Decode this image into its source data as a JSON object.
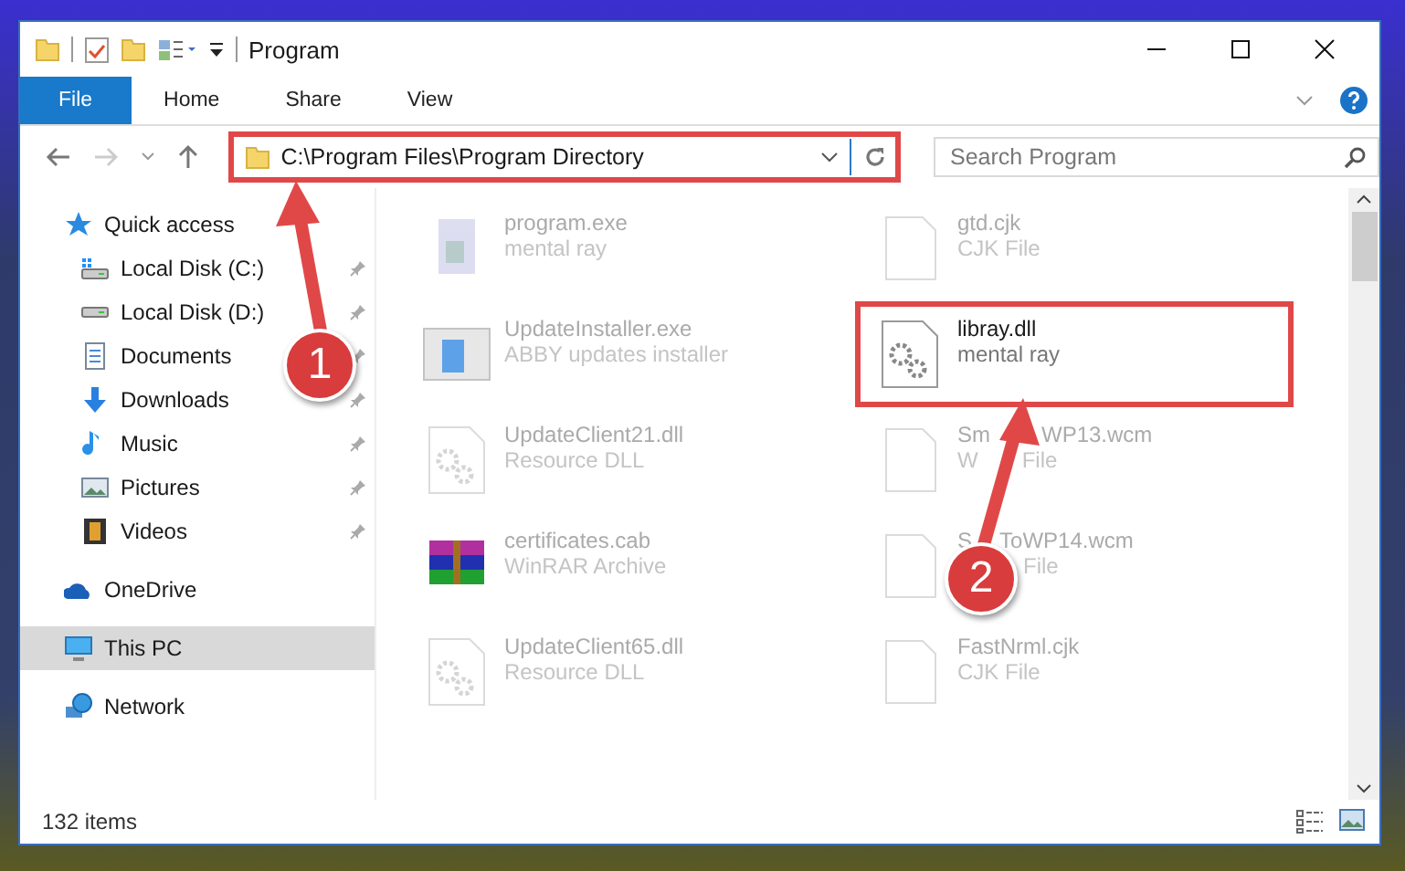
{
  "window": {
    "title": "Program"
  },
  "ribbon": {
    "tabs": [
      {
        "label": "File",
        "selected": true
      },
      {
        "label": "Home",
        "selected": false
      },
      {
        "label": "Share",
        "selected": false
      },
      {
        "label": "View",
        "selected": false
      }
    ]
  },
  "address": {
    "path": "C:\\Program Files\\Program Directory",
    "highlighted": true
  },
  "search": {
    "placeholder": "Search Program"
  },
  "sidebar": {
    "items": [
      {
        "label": "Quick access",
        "kind": "star",
        "selected": false,
        "children": [
          {
            "label": "Local Disk (C:)",
            "kind": "disk-c",
            "pinned": true,
            "selected": false
          },
          {
            "label": "Local Disk (D:)",
            "kind": "disk",
            "pinned": true,
            "selected": false
          },
          {
            "label": "Documents",
            "kind": "document",
            "pinned": true,
            "selected": false
          },
          {
            "label": "Downloads",
            "kind": "download",
            "pinned": true,
            "selected": false
          },
          {
            "label": "Music",
            "kind": "music",
            "pinned": true,
            "selected": false
          },
          {
            "label": "Pictures",
            "kind": "pictures",
            "pinned": true,
            "selected": false
          },
          {
            "label": "Videos",
            "kind": "video",
            "pinned": true,
            "selected": false
          }
        ]
      },
      {
        "label": "OneDrive",
        "kind": "cloud",
        "selected": false
      },
      {
        "label": "This PC",
        "kind": "pc",
        "selected": true
      },
      {
        "label": "Network",
        "kind": "network",
        "selected": false
      }
    ]
  },
  "files": [
    {
      "name": [
        "program.exe"
      ],
      "type": [
        "mental ray"
      ],
      "kind": "exe",
      "highlighted": false
    },
    {
      "name": [
        "UpdateInstaller.exe"
      ],
      "type": [
        "ABBY updates installer"
      ],
      "kind": "window",
      "highlighted": false
    },
    {
      "name": [
        "UpdateClient21.dll"
      ],
      "type": [
        "Resource DLL"
      ],
      "kind": "dll-faded",
      "highlighted": false
    },
    {
      "name": [
        "certificates.cab"
      ],
      "type": [
        "WinRAR Archive"
      ],
      "kind": "archive",
      "highlighted": false
    },
    {
      "name": [
        "UpdateClient65.dll"
      ],
      "type": [
        "Resource DLL"
      ],
      "kind": "dll-faded",
      "highlighted": false
    },
    {
      "name": [
        "gtd.cjk"
      ],
      "type": [
        "CJK File"
      ],
      "kind": "blank",
      "highlighted": false
    },
    {
      "name": [
        "libray.dll"
      ],
      "type": [
        "mental ray"
      ],
      "kind": "dll",
      "highlighted": true
    },
    {
      "name": [
        "Sm",
        "WP13.wcm"
      ],
      "type": [
        "W",
        "File"
      ],
      "kind": "blank",
      "highlighted": false
    },
    {
      "name": [
        "S",
        "ToWP14.wcm"
      ],
      "type": [
        "File"
      ],
      "kind": "blank",
      "highlighted": false
    },
    {
      "name": [
        "FastNrml.cjk"
      ],
      "type": [
        "CJK File"
      ],
      "kind": "blank",
      "highlighted": false
    }
  ],
  "annotations": [
    {
      "label": "1"
    },
    {
      "label": "2"
    }
  ],
  "status_bar": {
    "count": "132 items"
  }
}
